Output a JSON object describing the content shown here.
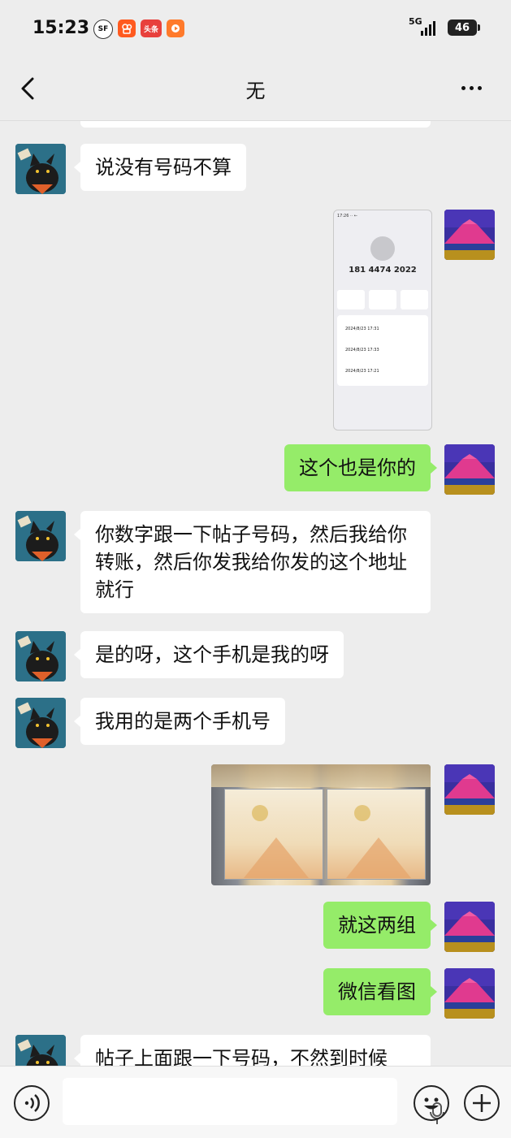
{
  "status_bar": {
    "time": "15:23",
    "app_icons": [
      {
        "name": "sf-express-icon",
        "label": "SF",
        "color": "#ffffff"
      },
      {
        "name": "kuaishou-icon",
        "label": "",
        "color": "#ff5a1f"
      },
      {
        "name": "toutiao-icon",
        "label": "头条",
        "color": "#e8403c"
      },
      {
        "name": "video-app-icon",
        "label": "",
        "color": "#ff7a2b"
      }
    ],
    "network": "5G",
    "battery": "46"
  },
  "header": {
    "title": "无"
  },
  "messages": [
    {
      "type": "text",
      "side": "in",
      "text": "说没有号码不算"
    },
    {
      "type": "image",
      "side": "out",
      "content": "phone-call-log-screenshot",
      "screenshot_text": {
        "number": "181 4474 2022",
        "calls": [
          "2024/8/23 17:31",
          "2024/8/23 17:33",
          "2024/8/23 17:21"
        ]
      }
    },
    {
      "type": "text",
      "side": "out",
      "text": "这个也是你的"
    },
    {
      "type": "text",
      "side": "in",
      "text": "你数字跟一下帖子号码，然后我给你转账，然后你发我给你发的这个地址就行"
    },
    {
      "type": "text",
      "side": "in",
      "text": "是的呀，这个手机是我的呀"
    },
    {
      "type": "text",
      "side": "in",
      "text": "我用的是两个手机号"
    },
    {
      "type": "image",
      "side": "out",
      "content": "banknote-packs-photo"
    },
    {
      "type": "text",
      "side": "out",
      "text": "就这两组"
    },
    {
      "type": "text",
      "side": "out",
      "text": "微信看图"
    },
    {
      "type": "text",
      "side": "in",
      "text": "帖子上面跟一下号码，不然到时候"
    }
  ],
  "colors": {
    "background": "#ededed",
    "incoming_bubble": "#ffffff",
    "outgoing_bubble": "#95ec69"
  },
  "input_bar": {
    "voice_icon": "voice-toggle-icon",
    "mic_icon": "microphone-icon",
    "emoji_icon": "emoji-icon",
    "plus_icon": "plus-icon"
  }
}
